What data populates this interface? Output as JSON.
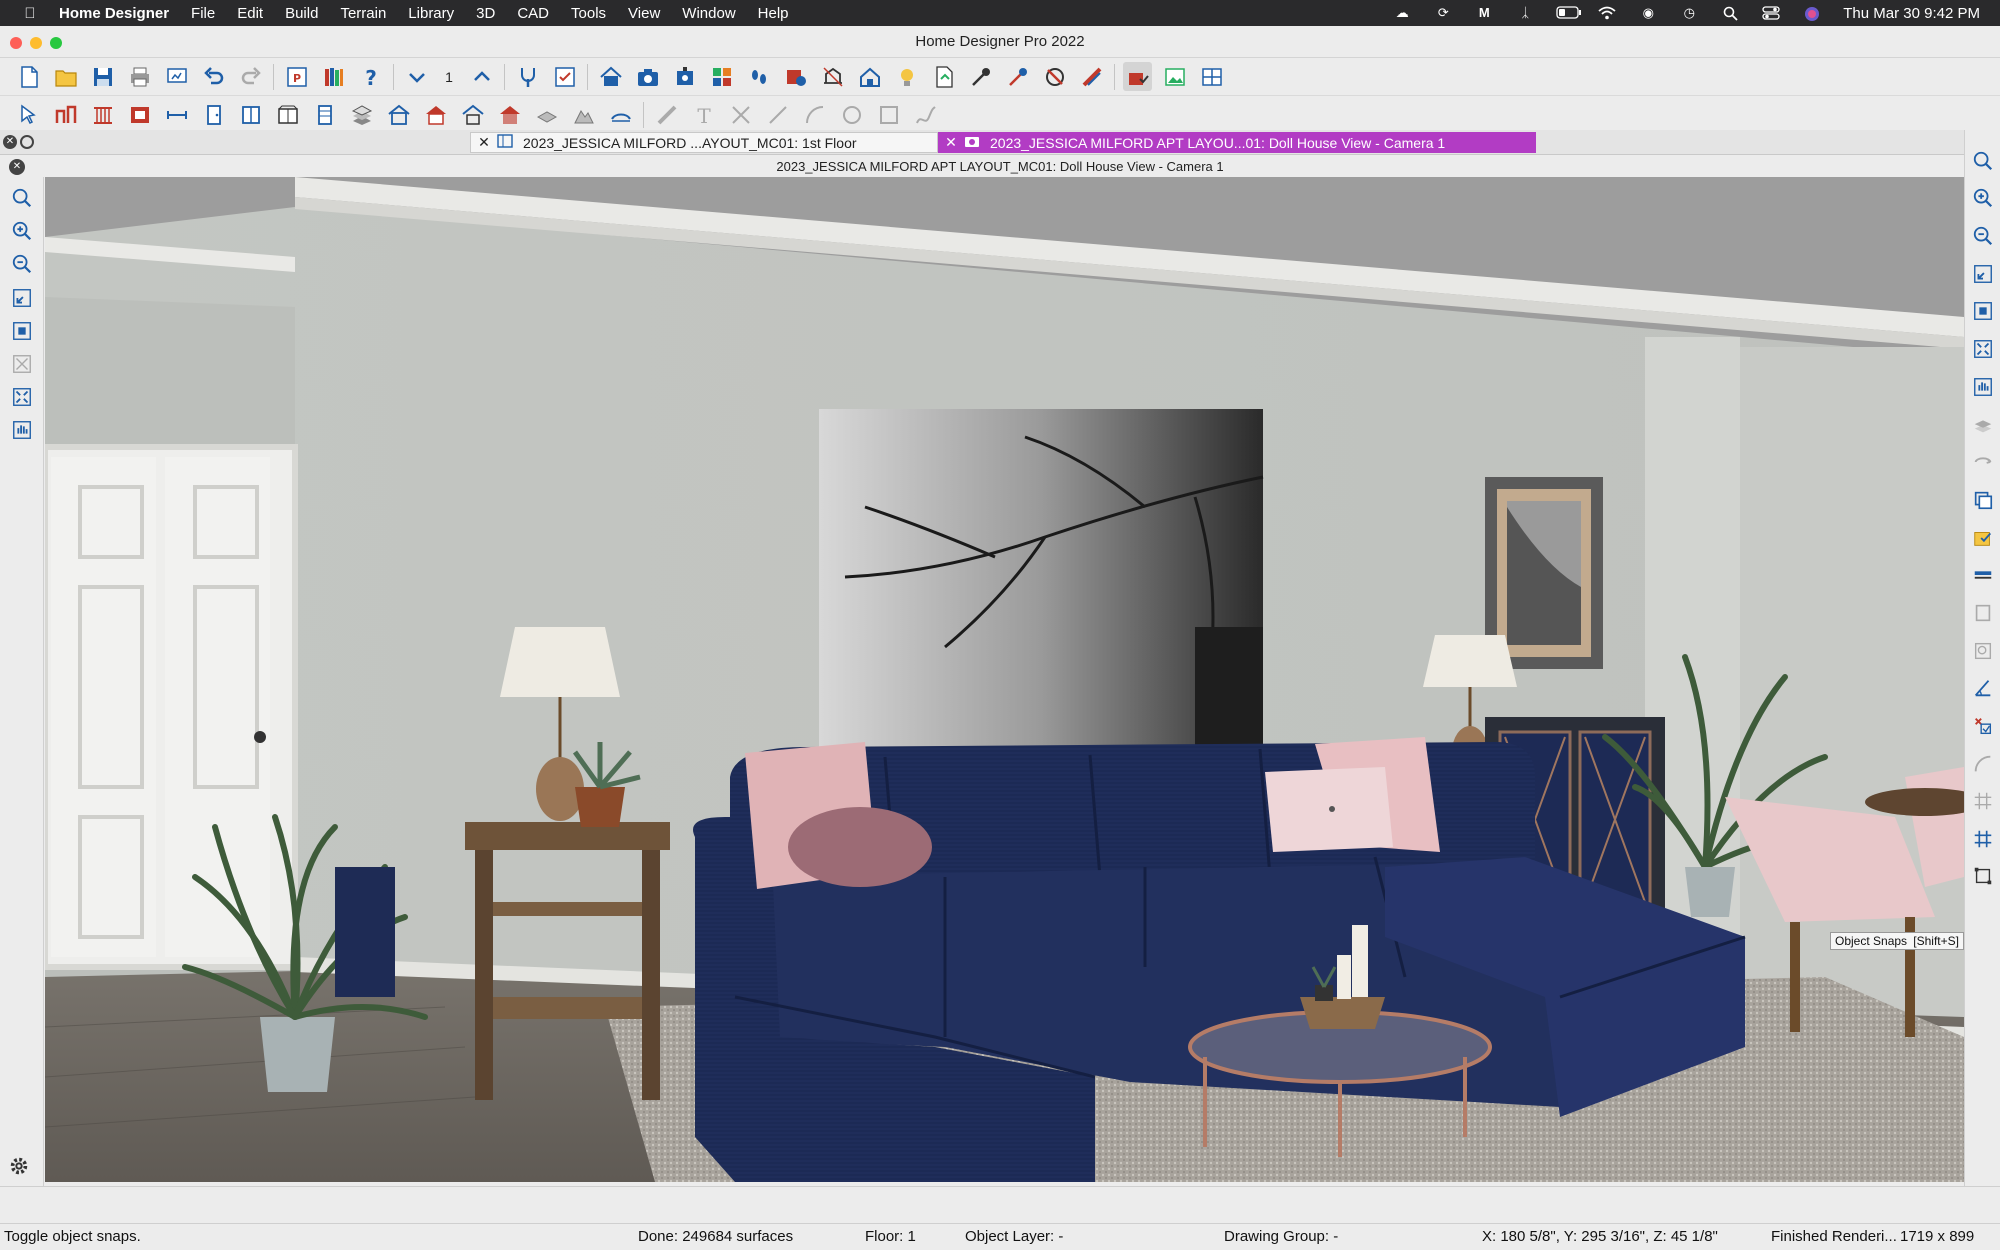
{
  "menubar": {
    "app_name": "Home Designer",
    "items": [
      "File",
      "Edit",
      "Build",
      "Terrain",
      "Library",
      "3D",
      "CAD",
      "Tools",
      "View",
      "Window",
      "Help"
    ],
    "clock": "Thu Mar 30  9:42 PM"
  },
  "window": {
    "title": "Home Designer Pro 2022"
  },
  "toolbar": {
    "floor_number": "1"
  },
  "tabs": [
    {
      "label": "2023_JESSICA MILFORD ...AYOUT_MC01: 1st Floor",
      "active": false
    },
    {
      "label": "2023_JESSICA MILFORD APT LAYOU...01: Doll House View - Camera 1",
      "active": true
    }
  ],
  "view": {
    "title": "2023_JESSICA MILFORD APT LAYOUT_MC01: Doll House View - Camera 1"
  },
  "tooltip": {
    "label": "Object Snaps",
    "shortcut": "[Shift+S]"
  },
  "status": {
    "hint": "Toggle object snaps.",
    "done": "Done:  249684 surfaces",
    "floor": "Floor: 1",
    "object_layer": "Object Layer: -",
    "drawing_group": "Drawing Group: -",
    "coords": "X: 180 5/8\", Y: 295 3/16\", Z: 45 1/8\"",
    "render": "Finished Renderi...",
    "size": "1719 x 899"
  },
  "colors": {
    "active_tab": "#b23cc4",
    "icon_blue": "#1f5fa8",
    "icon_red": "#c0392b",
    "sofa": "#1d2a55",
    "wall": "#c5c8c4"
  }
}
